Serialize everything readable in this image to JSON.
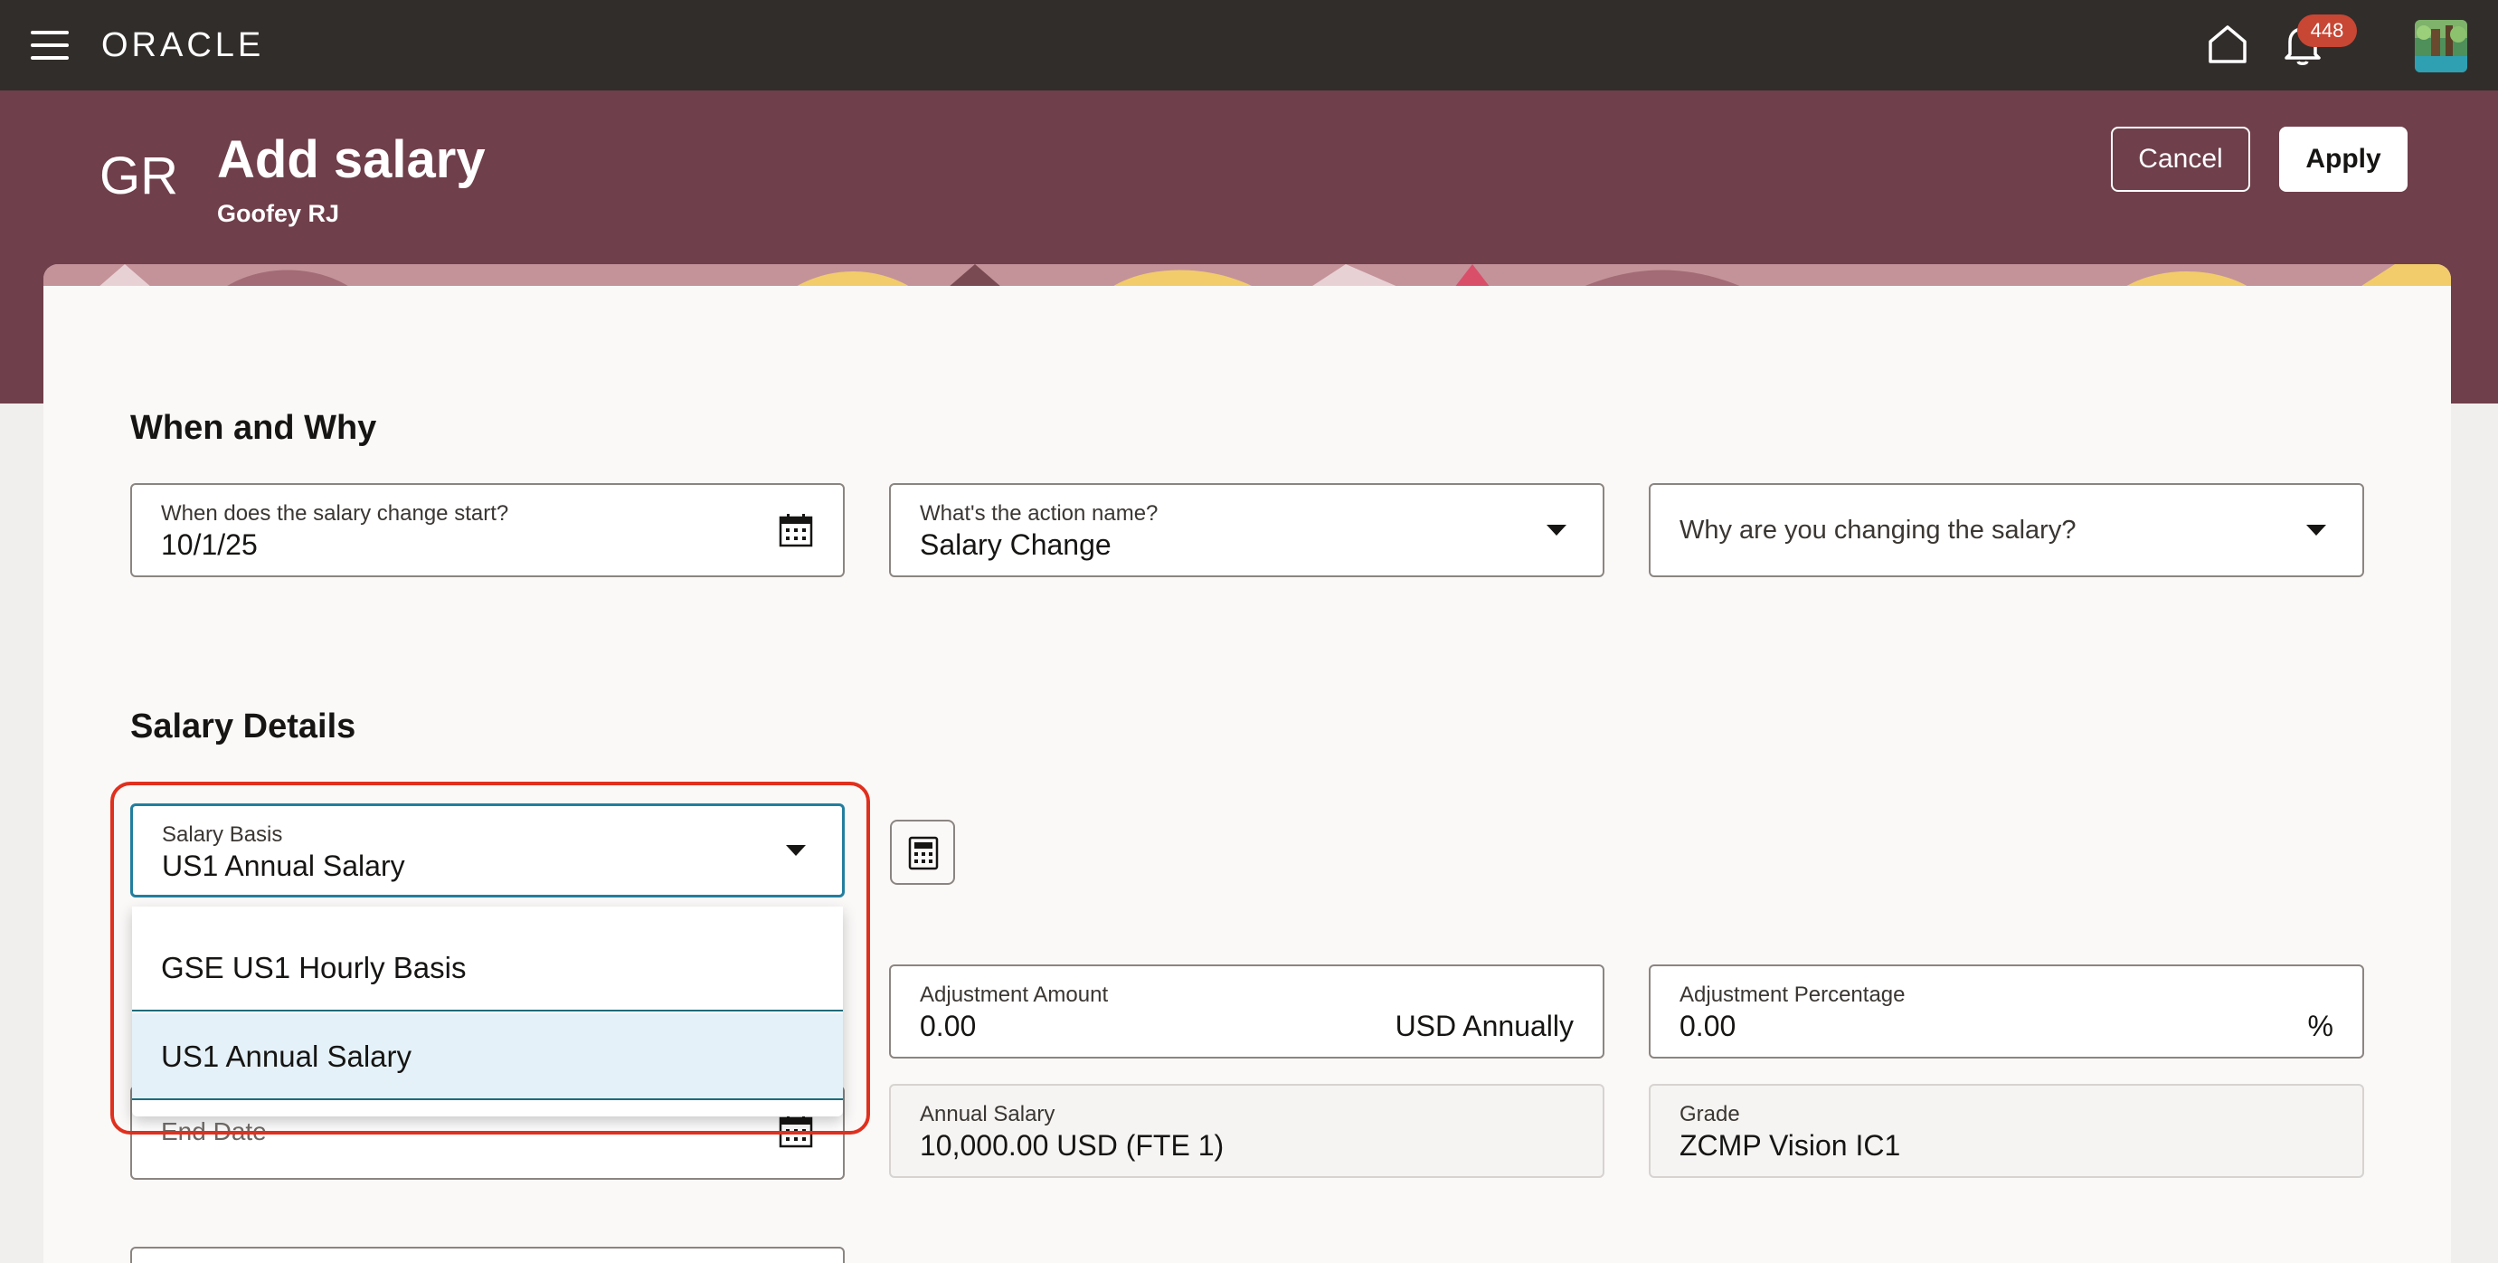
{
  "topbar": {
    "logo": "ORACLE",
    "notifications_count": "448",
    "icons": {
      "menu": "hamburger-menu-icon",
      "home": "home-icon",
      "bell": "bell-icon",
      "avatar": "avatar"
    }
  },
  "header": {
    "initials": "GR",
    "title": "Add salary",
    "subtitle": "Goofey RJ",
    "cancel_label": "Cancel",
    "apply_label": "Apply"
  },
  "when_why": {
    "title": "When and Why",
    "start_date": {
      "label": "When does the salary change start?",
      "value": "10/1/25"
    },
    "action": {
      "label": "What's the action name?",
      "value": "Salary Change"
    },
    "reason": {
      "placeholder": "Why are you changing the salary?"
    }
  },
  "salary_details": {
    "title": "Salary Details",
    "salary_basis": {
      "label": "Salary Basis",
      "value": "US1 Annual Salary"
    },
    "options": [
      "GSE US1 Hourly Basis",
      "US1 Annual Salary"
    ],
    "selected_option": "US1 Annual Salary",
    "adjustment_amount": {
      "label": "Adjustment Amount",
      "value": "0.00",
      "suffix": "USD Annually"
    },
    "adjustment_percentage": {
      "label": "Adjustment Percentage",
      "value": "0.00",
      "suffix": "%"
    },
    "end_date": {
      "label": "End Date"
    },
    "annual_salary": {
      "label": "Annual Salary",
      "value": "10,000.00 USD (FTE 1)"
    },
    "grade": {
      "label": "Grade",
      "value": "ZCMP Vision IC1"
    }
  },
  "colors": {
    "topbar": "#312d2a",
    "header": "#6f3f4b",
    "focus": "#227e9e",
    "highlight": "#e0301e",
    "badge": "#c74634"
  }
}
